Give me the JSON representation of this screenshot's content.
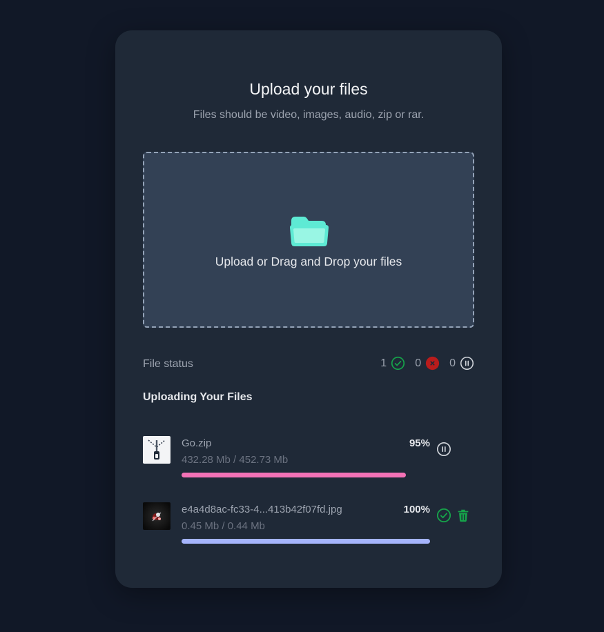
{
  "header": {
    "title": "Upload your files",
    "subtitle": "Files should be video, images, audio, zip or rar."
  },
  "dropzone": {
    "label": "Upload or Drag and Drop your files",
    "icon": "folder-icon",
    "icon_color": "#5eead4"
  },
  "status": {
    "label": "File status",
    "completed": "1",
    "failed": "0",
    "paused": "0",
    "completed_color": "#16a34a",
    "failed_color": "#b91c1c"
  },
  "uploads": {
    "title": "Uploading Your Files",
    "files": [
      {
        "name": "Go.zip",
        "size": "432.28 Mb / 452.73 Mb",
        "percent": "95%",
        "progress": 0.95,
        "bar_color": "#f472b6",
        "action": "pause-icon"
      },
      {
        "name": "e4a4d8ac-fc33-4...413b42f07fd.jpg",
        "size": "0.45 Mb / 0.44 Mb",
        "percent": "100%",
        "progress": 1.0,
        "bar_color": "#a5b4fc",
        "action": "check-circle-icon",
        "secondary_action": "trash-icon"
      }
    ]
  },
  "colors": {
    "background": "#111827",
    "card": "#1f2937",
    "dropzone": "#334155"
  }
}
